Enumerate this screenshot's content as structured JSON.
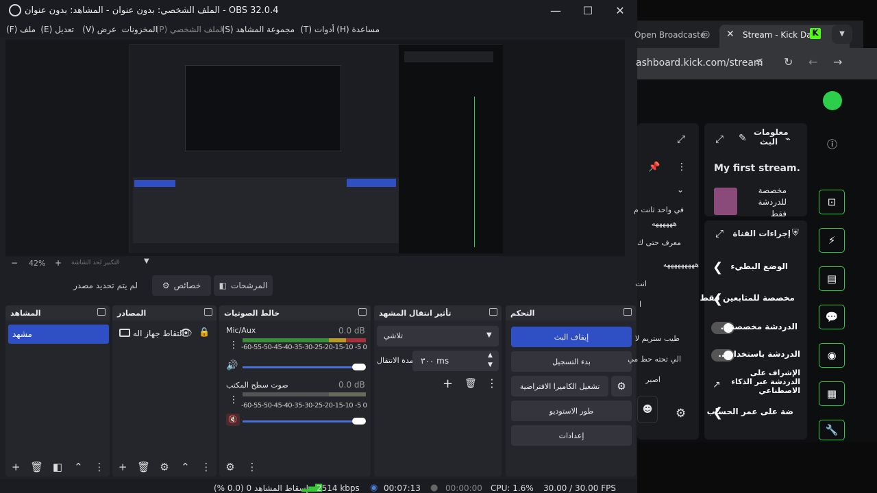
{
  "window": {
    "title": "الملف الشخصي: بدون عنوان - المشاهد: بدون عنوان - OBS 32.0.4",
    "minimize": "—",
    "maximize": "☐",
    "close": "✕"
  },
  "menu": [
    {
      "label": "ملف (F)"
    },
    {
      "label": "تعديل (E)"
    },
    {
      "label": "عرض (V)"
    },
    {
      "label": "المخزونات"
    },
    {
      "label": "الملف الشخصي (P)"
    },
    {
      "label": "مجموعة المشاهد (S)"
    },
    {
      "label": "أدوات (T)"
    },
    {
      "label": "مساعدة (H)"
    }
  ],
  "zoom": {
    "minus": "−",
    "value": "42%",
    "plus": "+",
    "fit_label": "التكبير لحد الشاشة"
  },
  "source_bar": {
    "no_source": "لم يتم تحديد مصدر",
    "properties": "خصائص",
    "filters": "المرشحات"
  },
  "scenes": {
    "title": "المشاهد",
    "items": [
      "مشهد"
    ]
  },
  "sources": {
    "title": "المصادر",
    "items": [
      "التقاط جهاز اله"
    ]
  },
  "mixer": {
    "title": "خالط الصوتيات",
    "channels": [
      {
        "name": "Mic/Aux",
        "db": "0.0 dB",
        "ticks": "-60-55-50-45-40-35-30-25-20-15-10 -5  0"
      },
      {
        "name": "صوت سطح المكتب",
        "db": "0.0 dB",
        "ticks": "-60-55-50-45-40-35-30-25-20-15-10 -5  0"
      }
    ]
  },
  "transitions": {
    "title": "تأثير انتقال المشهد",
    "type": "تلاشي",
    "duration_label": "مدة الانتقال",
    "duration_value": "٣٠٠ ms"
  },
  "controls": {
    "title": "التحكم",
    "stop_stream": "إيقاف البث",
    "start_recording": "بدء التسجيل",
    "virtual_camera": "تشغيل الكاميرا الافتراضية",
    "studio_mode": "طور الاستوديو",
    "settings": "إعدادات"
  },
  "status": {
    "dropped": "إسقاط المشاهد 0 (0.0 %)",
    "bitrate": "2514 kbps",
    "stream_time": "00:07:13",
    "rec_time": "00:00:00",
    "cpu": "CPU: 1.6%",
    "fps": "30.00 / 30.00 FPS"
  },
  "browser": {
    "tab1": "Open Broadcaste",
    "tab2": "Stream - Kick Da",
    "url": "ashboard.kick.com/stream"
  },
  "kick": {
    "info_title": "معلومات البث",
    "stream_title": "My first stream.",
    "category": "مخصصة للدردشة فقط",
    "channel_actions": "إجراءات القناة",
    "rows": [
      {
        "label": "الوضع البطيء"
      },
      {
        "label": "مخصصة للمتابعين فقط"
      },
      {
        "label": "الدردشة مخصصة..."
      },
      {
        "label": "الدردشة باستخدام..."
      },
      {
        "label": "الإشراف على الدردشة عبر الذكاء الاصطناعي"
      },
      {
        "label": "ضة على عمر الحساب"
      }
    ],
    "chat_lines": [
      "في واحد ثانت م",
      "ههههههه",
      "معرف حتى ك",
      "هههههههههه",
      "انت",
      "ا",
      "طيب ستريم لا",
      "الي تحته حط مي",
      "اصبر"
    ]
  },
  "colors": {
    "accent": "#2f4fc5",
    "kick_green": "#53fc18"
  }
}
